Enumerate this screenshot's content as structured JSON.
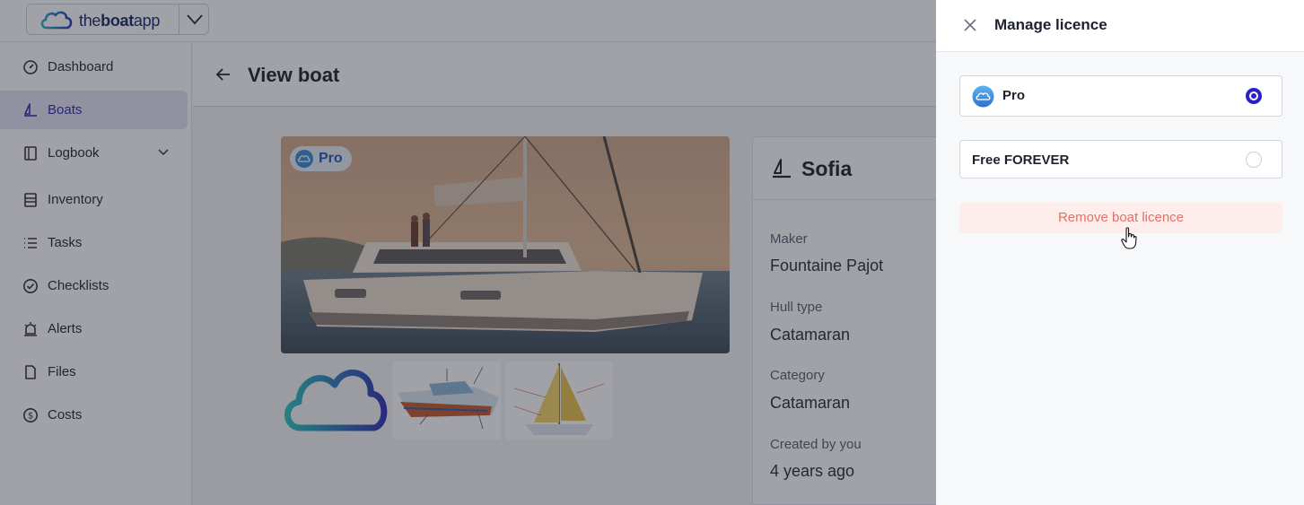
{
  "app": {
    "brand": {
      "pre": "the",
      "bold": "boat",
      "post": "app"
    }
  },
  "sidebar": {
    "items": [
      {
        "label": "Dashboard",
        "icon": "dashboard-icon"
      },
      {
        "label": "Boats",
        "icon": "boat-icon",
        "active": true
      },
      {
        "label": "Logbook",
        "icon": "logbook-icon",
        "expandable": true
      },
      {
        "label": "Inventory",
        "icon": "inventory-icon"
      },
      {
        "label": "Tasks",
        "icon": "tasks-icon"
      },
      {
        "label": "Checklists",
        "icon": "checklist-icon"
      },
      {
        "label": "Alerts",
        "icon": "alert-icon"
      },
      {
        "label": "Files",
        "icon": "file-icon"
      },
      {
        "label": "Costs",
        "icon": "cost-icon"
      }
    ]
  },
  "page": {
    "title": "View boat",
    "badge": "Pro"
  },
  "boat": {
    "name": "Sofia",
    "fields": [
      {
        "label": "Maker",
        "value": "Fountaine Pajot"
      },
      {
        "label": "Hull type",
        "value": "Catamaran"
      },
      {
        "label": "Category",
        "value": "Catamaran"
      },
      {
        "label": "Created by you",
        "value": "4 years ago"
      }
    ]
  },
  "drawer": {
    "title": "Manage licence",
    "options": [
      {
        "label": "Pro",
        "selected": true,
        "icon": "cloud-icon"
      },
      {
        "label": "Free FOREVER",
        "selected": false
      }
    ],
    "remove_label": "Remove boat licence"
  },
  "colors": {
    "accent": "#2c21c4",
    "active_nav_bg": "#e4e2f6",
    "danger_text": "#e57067",
    "danger_bg": "#fdeeec"
  }
}
